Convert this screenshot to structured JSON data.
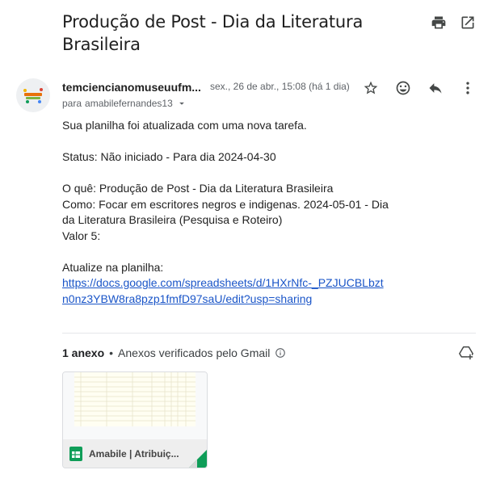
{
  "subject": "Produção de Post - Dia da Literatura Brasileira",
  "sender": {
    "name": "temciencianomuseuufm...",
    "avatar_icon": "ciencia-no-museu-logo",
    "date": "sex., 26 de abr., 15:08 (há 1 dia)",
    "recipient_prefix": "para",
    "recipient": "amabilefernandes13"
  },
  "icons": {
    "print": "print-icon",
    "open_new_window": "open-in-new-window-icon",
    "star": "star-icon",
    "emoji": "emoji-icon",
    "reply": "reply-icon",
    "more": "more-vert-icon",
    "info": "info-icon",
    "add_to_drive": "add-to-drive-icon",
    "sheets": "google-sheets-icon"
  },
  "body": {
    "line1": "Sua planilha foi atualizada com uma nova tarefa.",
    "status": "Status: Não iniciado - Para dia 2024-04-30",
    "what": "O quê: Produção de Post - Dia da Literatura Brasileira",
    "how": "Como: Focar em escritores negros e indigenas. 2024-05-01 - Dia da Literatura Brasileira (Pesquisa e Roteiro)",
    "value": "Valor 5:",
    "update_label": "Atualize na planilha:",
    "link": "https://docs.google.com/spreadsheets/d/1HXrNfc-_PZJUCBLbztn0nz3YBW8ra8pzp1fmfD97saU/edit?usp=sharing"
  },
  "attachments": {
    "count_label": "1 anexo",
    "separator": "•",
    "verified_label": "Anexos verificados pelo Gmail",
    "file_name": "Amabile | Atribuiç...",
    "colors": {
      "sheets_green": "#0f9d58",
      "link_blue": "#1a55c8"
    }
  }
}
